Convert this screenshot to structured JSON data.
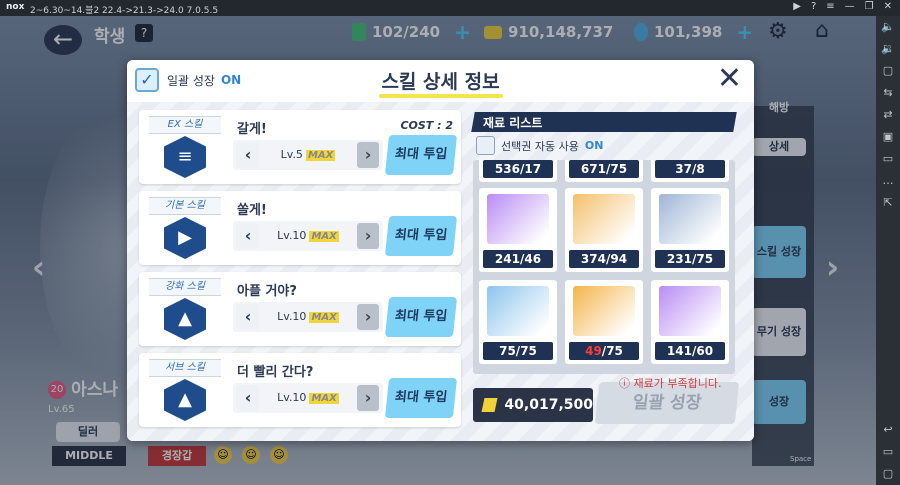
{
  "emulator": {
    "logo": "nox",
    "title": "2~6.30~14.블2 22.4->21.3->24.0 7.0.5.5",
    "controls": [
      "▶",
      "?",
      "≡",
      "—",
      "❐",
      "✕"
    ],
    "side_icons": [
      "🔈",
      "🔉",
      "▢",
      "⇆",
      "⇄",
      "▣",
      "▭",
      "…",
      "⇱"
    ],
    "side_icons_bottom": [
      "↩",
      "▭",
      "▢"
    ]
  },
  "game": {
    "page_title": "학생",
    "help_label": "?",
    "stamina": "102/240",
    "credits": "910,148,737",
    "gems": "101,398",
    "character": {
      "level_badge": "20",
      "name": "아스나",
      "level": "Lv.65",
      "role": "딜러",
      "position": "MIDDLE",
      "armor": "경장갑"
    },
    "right_menu": {
      "top_label": "해방",
      "detail_label": "상세",
      "skill_grow": "스킬 성장",
      "weapon_grow": "무기 성장",
      "grow": "성장"
    },
    "space_label": "Space"
  },
  "dialog": {
    "title": "스킬 상세 정보",
    "bulk_toggle_label": "일괄 성장",
    "bulk_toggle_state": "ON",
    "skills": [
      {
        "type": "EX 스킬",
        "name": "갈게!",
        "cost": "COST : 2",
        "level": "Lv.5",
        "max": "MAX",
        "button": "최대 투입",
        "icon": "≡"
      },
      {
        "type": "기본 스킬",
        "name": "쏠게!",
        "cost": "",
        "level": "Lv.10",
        "max": "MAX",
        "button": "최대 투입",
        "icon": "▶"
      },
      {
        "type": "강화 스킬",
        "name": "아플 거야?",
        "cost": "",
        "level": "Lv.10",
        "max": "MAX",
        "button": "최대 투입",
        "icon": "▲"
      },
      {
        "type": "서브 스킬",
        "name": "더 빨리 간다?",
        "cost": "",
        "level": "Lv.10",
        "max": "MAX",
        "button": "최대 투입",
        "icon": "▲"
      }
    ],
    "materials": {
      "header": "재료 리스트",
      "auto_use_label": "선택권 자동 사용",
      "auto_use_state": "ON",
      "top_row": [
        "536/17",
        "671/75",
        "37/8"
      ],
      "items": [
        {
          "have": "241",
          "need": "46",
          "short": false,
          "color": "#b98cf5"
        },
        {
          "have": "374",
          "need": "94",
          "short": false,
          "color": "#f5c06c"
        },
        {
          "have": "231",
          "need": "75",
          "short": false,
          "color": "#9fb6d6"
        },
        {
          "have": "75",
          "need": "75",
          "short": false,
          "color": "#8cc4ef"
        },
        {
          "have": "49",
          "need": "75",
          "short": true,
          "color": "#f5b44a"
        },
        {
          "have": "141",
          "need": "60",
          "short": false,
          "color": "#b98cf5"
        }
      ]
    },
    "credit_cost": "40,017,500",
    "warning": "재료가 부족합니다.",
    "bulk_button": "일괄 성장"
  },
  "colors": {
    "accent": "#7fd3f7",
    "navy": "#1f3254",
    "short": "#ff3b3b"
  }
}
